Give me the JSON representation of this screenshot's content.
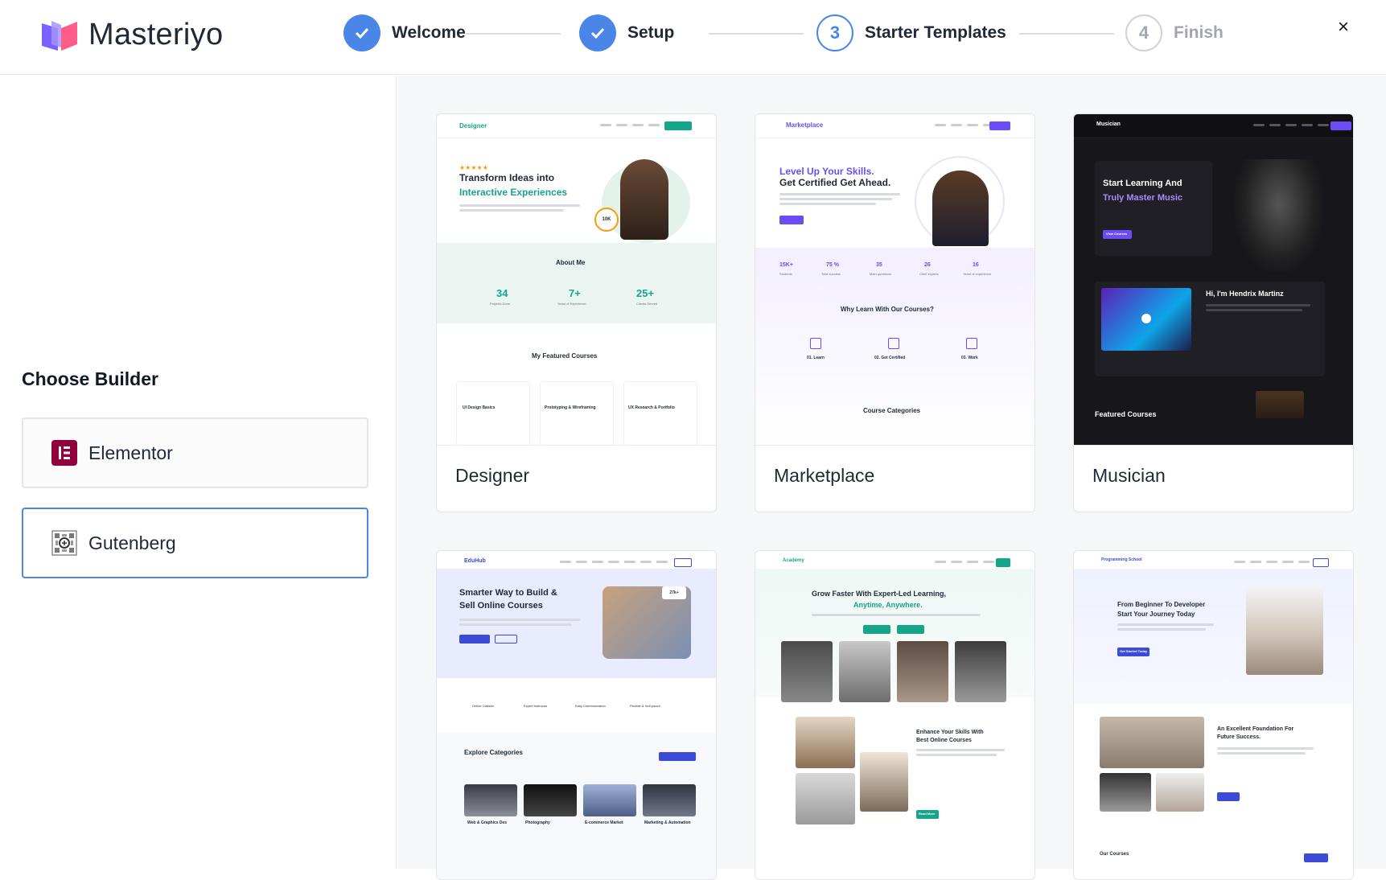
{
  "app": {
    "name": "Masteriyo"
  },
  "steps": [
    {
      "number": "1",
      "label": "Welcome",
      "state": "done"
    },
    {
      "number": "2",
      "label": "Setup",
      "state": "done"
    },
    {
      "number": "3",
      "label": "Starter Templates",
      "state": "current"
    },
    {
      "number": "4",
      "label": "Finish",
      "state": "todo"
    }
  ],
  "close_glyph": "×",
  "sidebar": {
    "title": "Choose Builder",
    "builders": [
      {
        "label": "Elementor",
        "icon": "elementor-icon",
        "selected": false
      },
      {
        "label": "Gutenberg",
        "icon": "gutenberg-icon",
        "selected": true
      }
    ]
  },
  "templates": [
    {
      "name": "Designer",
      "preview": {
        "hero_line1": "Transform Ideas into",
        "hero_line2": "Interactive Experiences",
        "section1": "About Me",
        "stats": [
          "34",
          "7+",
          "25+"
        ],
        "stat_labels": [
          "Projects Done",
          "Years of Experience",
          "Clients Served"
        ],
        "section2": "My Featured Courses",
        "courses": [
          "UI Design Basics",
          "Prototyping & Wireframing",
          "UX Research & Portfolio"
        ],
        "brand": "Designer",
        "badge": "10K"
      }
    },
    {
      "name": "Marketplace",
      "preview": {
        "brand": "Marketplace",
        "hero_line1": "Level Up Your Skills.",
        "hero_line2": "Get Certified Get Ahead.",
        "stats": [
          "15K+",
          "75 %",
          "35",
          "26",
          "16"
        ],
        "stat_labels": [
          "Students",
          "Total success",
          "Main questions",
          "Chief experts",
          "Years of experience"
        ],
        "section1": "Why Learn With Our Courses?",
        "features": [
          "01. Learn",
          "02. Get Certified",
          "03. Work"
        ],
        "section2": "Course Categories"
      }
    },
    {
      "name": "Musician",
      "preview": {
        "brand": "Musician",
        "hero_line1": "Start Learning And",
        "hero_line2": "Truly Master Music",
        "section1": "Hi, I'm Hendrix Martinz",
        "section2": "Featured Courses",
        "cta": "View Courses"
      }
    },
    {
      "name": "EduHub",
      "preview": {
        "brand": "EduHub",
        "hero_line1": "Smarter Way to Build &",
        "hero_line2": "Sell Online Courses",
        "badge": "27k+",
        "features": [
          "Online Classes",
          "Expert Instructor",
          "Easy Communication",
          "Flexible & Self-paced"
        ],
        "section2": "Explore Categories",
        "cats": [
          "Web & Graphics Des",
          "Photography",
          "E-commerce Market",
          "Marketing & Automation"
        ],
        "cta": "View All Categories"
      }
    },
    {
      "name": "Academy",
      "preview": {
        "brand": "Academy",
        "hero_line1": "Grow Faster With Expert-Led Learning,",
        "hero_line2": "Anytime, Anywhere.",
        "section1": "Enhance Your Skills With",
        "section1b": "Best Online Courses",
        "cta": "Read More"
      }
    },
    {
      "name": "Programming School",
      "preview": {
        "brand": "Programming School",
        "hero_line1": "From Beginner To Developer",
        "hero_line2": "Start Your Journey Today",
        "section1": "An Excellent Foundation For",
        "section1b": "Future Success.",
        "section2": "Our Courses",
        "cta": "Get Started Today"
      }
    }
  ],
  "colors": {
    "accent": "#4a86e8",
    "teal": "#17a589",
    "purple": "#6c4cf5",
    "dark": "#17171b"
  }
}
